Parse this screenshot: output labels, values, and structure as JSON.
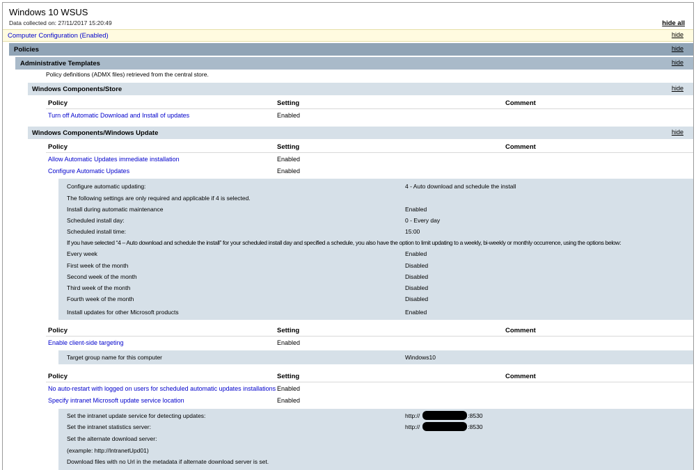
{
  "report": {
    "title": "Windows 10 WSUS",
    "collected": "Data collected on: 27/11/2017 15:20:49",
    "hide_all": "hide all",
    "hide": "hide"
  },
  "sections": {
    "computer_config": "Computer Configuration (Enabled)",
    "policies": "Policies",
    "admin_templates": "Administrative Templates",
    "admx_note": "Policy definitions (ADMX files) retrieved from the central store.",
    "store": "Windows Components/Store",
    "windows_update": "Windows Components/Windows Update"
  },
  "columns": {
    "policy": "Policy",
    "setting": "Setting",
    "comment": "Comment"
  },
  "store_policies": [
    {
      "name": "Turn off Automatic Download and Install of updates",
      "setting": "Enabled"
    }
  ],
  "wu_group1": [
    {
      "name": "Allow Automatic Updates immediate installation",
      "setting": "Enabled"
    },
    {
      "name": "Configure Automatic Updates",
      "setting": "Enabled"
    }
  ],
  "wu_group1_details": [
    {
      "label": "Configure automatic updating:",
      "value": "4 - Auto download and schedule the install"
    },
    {
      "label": "The following settings are only required and applicable if 4 is selected.",
      "value": ""
    },
    {
      "label": "Install during automatic maintenance",
      "value": "Enabled"
    },
    {
      "label": "Scheduled install day:",
      "value": "0 - Every day"
    },
    {
      "label": "Scheduled install time:",
      "value": "15:00"
    },
    {
      "label": "If you have selected “4 – Auto download and schedule the install” for your scheduled install day and specified a schedule, you also have the option to limit updating to a weekly, bi-weekly or monthly occurrence, using the options below:",
      "value": ""
    },
    {
      "label": "Every week",
      "value": "Enabled"
    },
    {
      "label": "First week of the month",
      "value": "Disabled"
    },
    {
      "label": "Second week of the month",
      "value": "Disabled"
    },
    {
      "label": "Third week of the month",
      "value": "Disabled"
    },
    {
      "label": "Fourth week of the month",
      "value": "Disabled"
    },
    {
      "label": "Install updates for other Microsoft products",
      "value": "Enabled"
    }
  ],
  "wu_group2": [
    {
      "name": "Enable client-side targeting",
      "setting": "Enabled"
    }
  ],
  "wu_group2_details": [
    {
      "label": "Target group name for this computer",
      "value": "Windows10"
    }
  ],
  "wu_group3": [
    {
      "name": "No auto-restart with logged on users for scheduled automatic updates installations",
      "setting": "Enabled"
    },
    {
      "name": "Specify intranet Microsoft update service location",
      "setting": "Enabled"
    }
  ],
  "wu_group3_details": [
    {
      "label": "Set the intranet update service for detecting updates:",
      "value_prefix": "http://",
      "value_suffix": ":8530"
    },
    {
      "label": "Set the intranet statistics server:",
      "value_prefix": "http://",
      "value_suffix": ":8530"
    },
    {
      "label": "Set the alternate download server:",
      "value_prefix": "",
      "value_suffix": ""
    },
    {
      "label": "(example: http://IntranetUpd01)",
      "value_prefix": "",
      "value_suffix": ""
    },
    {
      "label": "Download files with no Url in the metadata if alternate download server is set.",
      "value_prefix": "",
      "value_suffix": ""
    }
  ]
}
